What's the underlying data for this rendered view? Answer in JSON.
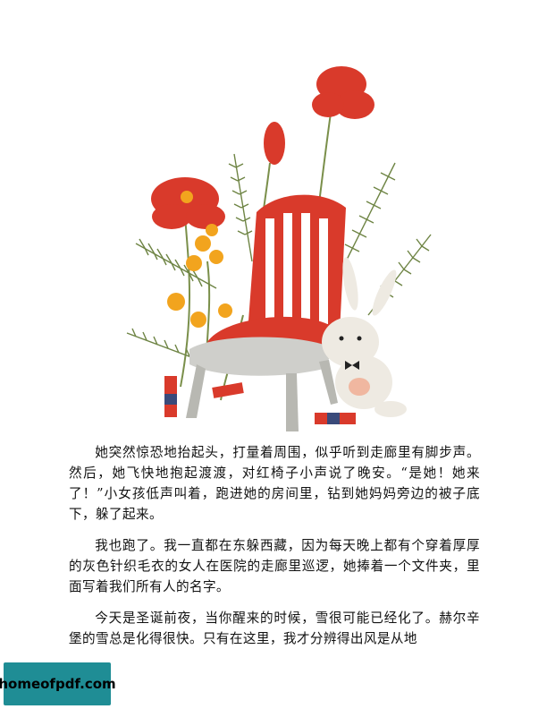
{
  "paragraphs": [
    "她突然惊恐地抬起头，打量着周围，似乎听到走廊里有脚步声。然后，她飞快地抱起渡渡，对红椅子小声说了晚安。“是她！她来了！”小女孩低声叫着，跑进她的房间里，钻到她妈妈旁边的被子底下，躲了起来。",
    "我也跑了。我一直都在东躲西藏，因为每天晚上都有个穿着厚厚的灰色针织毛衣的女人在医院的走廊里巡逻，她捧着一个文件夹，里面写着我们所有人的名字。",
    "今天是圣诞前夜，当你醒来的时候，雪很可能已经化了。赫尔辛堡的雪总是化得很快。只有在这里，我才分辨得出风是从地"
  ],
  "watermark": {
    "text": "homeofpdf.com",
    "color": "#1f8d95"
  },
  "colors": {
    "chair_red": "#d93a2b",
    "chair_seat": "#cfcfcb",
    "flower_red": "#d93a2b",
    "flower_yellow": "#f2a41e",
    "leaf": "#7a8f4a"
  }
}
